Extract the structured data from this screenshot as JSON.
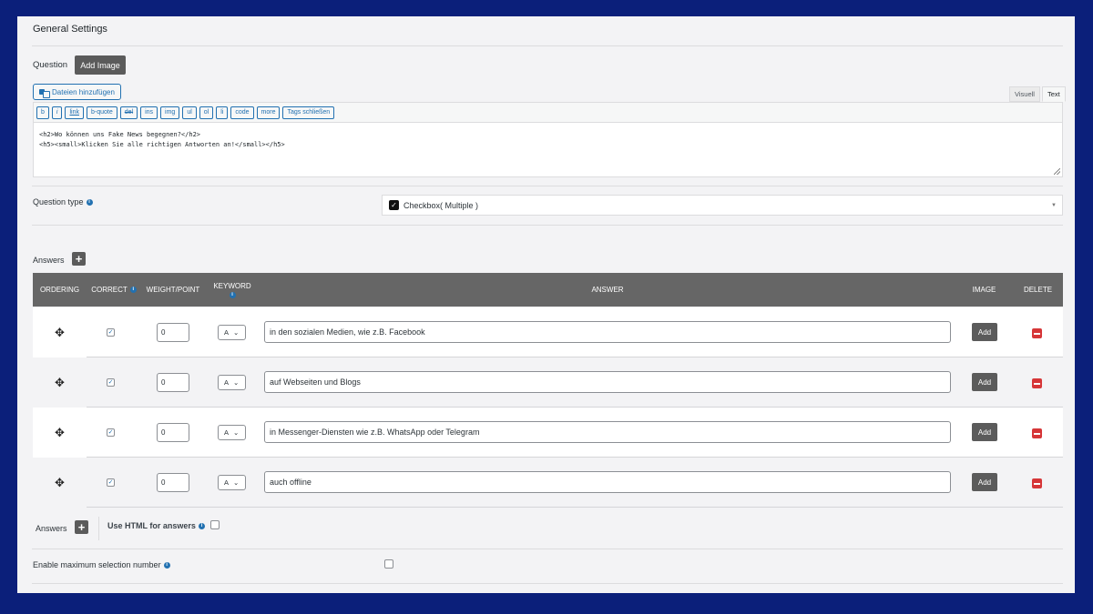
{
  "section": {
    "title": "General Settings"
  },
  "question": {
    "label": "Question",
    "add_image_label": "Add Image",
    "media_button_label": "Dateien hinzufügen",
    "tab_visual": "Visuell",
    "tab_text": "Text",
    "toolbar": [
      "b",
      "i",
      "link",
      "b-quote",
      "del",
      "ins",
      "img",
      "ul",
      "ol",
      "li",
      "code",
      "more",
      "Tags schließen"
    ],
    "content_line1": "<h2>Wo können uns Fake News begegnen?</h2>",
    "content_line2": "<h5><small>Klicken Sie alle richtigen Antworten an!</small></h5>"
  },
  "question_type": {
    "label": "Question type",
    "value": "Checkbox( Multiple )"
  },
  "answers": {
    "label": "Answers",
    "columns": {
      "ordering": "ORDERING",
      "correct": "CORRECT",
      "weight": "WEIGHT/POINT",
      "keyword": "KEYWORD",
      "answer": "ANSWER",
      "image": "IMAGE",
      "delete": "DELETE"
    },
    "add_label": "Add",
    "rows": [
      {
        "correct": true,
        "weight": "0",
        "keyword": "A",
        "answer": "in den sozialen Medien, wie z.B. Facebook"
      },
      {
        "correct": true,
        "weight": "0",
        "keyword": "A",
        "answer": "auf Webseiten und Blogs"
      },
      {
        "correct": true,
        "weight": "0",
        "keyword": "A",
        "answer": "in Messenger-Diensten wie z.B. WhatsApp oder Telegram"
      },
      {
        "correct": true,
        "weight": "0",
        "keyword": "A",
        "answer": "auch offline"
      }
    ]
  },
  "footer": {
    "answers_label": "Answers",
    "use_html_label": "Use HTML for answers",
    "max_selection_label": "Enable maximum selection number"
  },
  "icons": {
    "move": "move-arrows-icon",
    "info": "info-icon",
    "plus": "plus-icon",
    "delete": "minus-delete-icon"
  },
  "colors": {
    "frame": "#0b1f7a",
    "header_bg": "#666666",
    "button_bg": "#5b5b5b",
    "delete_red": "#d63638",
    "link_blue": "#2271b1"
  }
}
